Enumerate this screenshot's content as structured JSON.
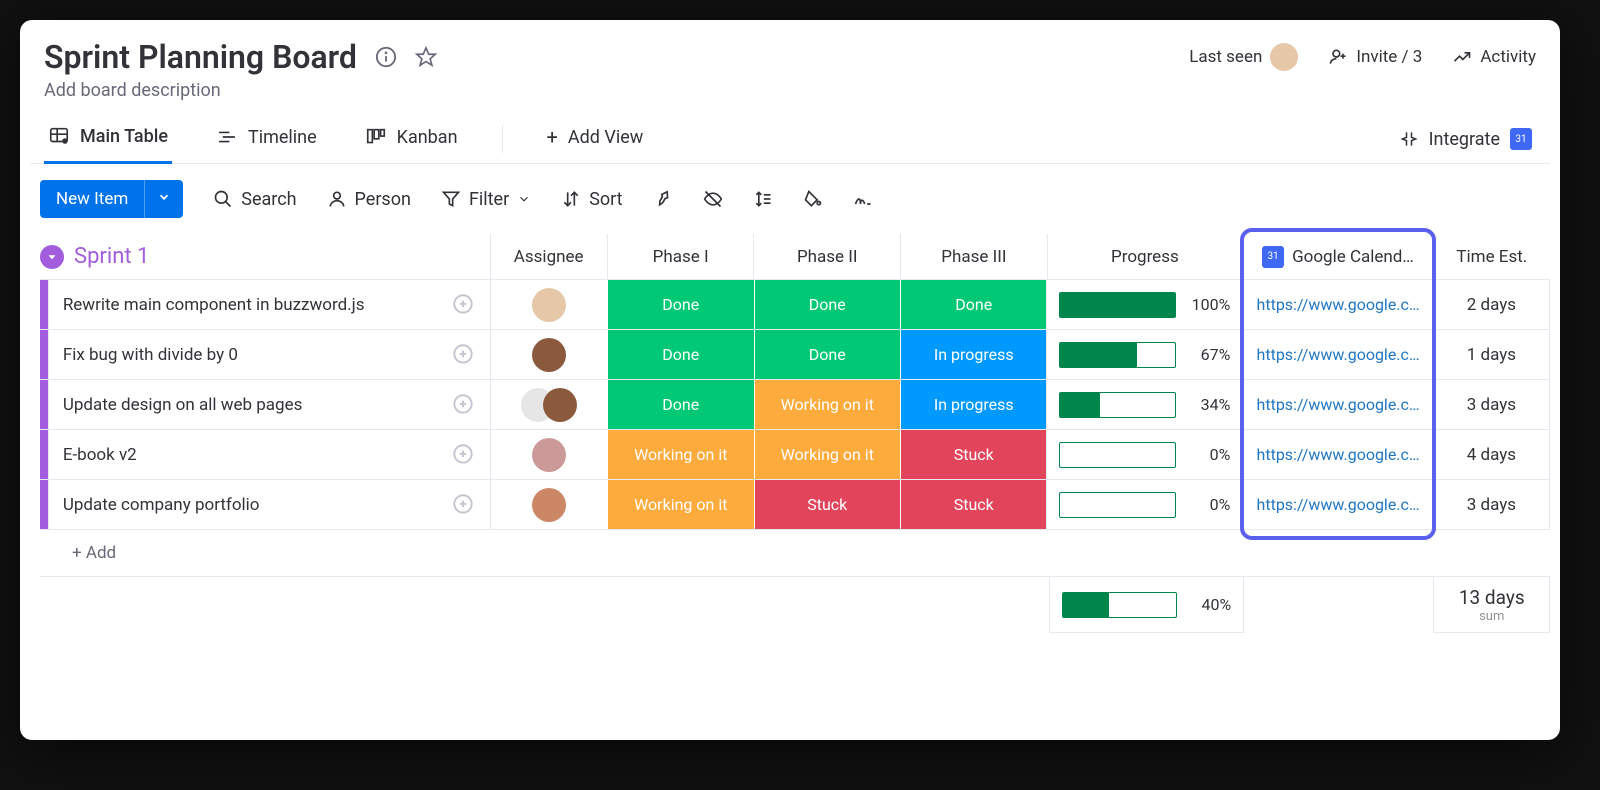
{
  "header": {
    "title": "Sprint Planning Board",
    "subtitle": "Add board description",
    "last_seen": "Last seen",
    "invite": "Invite / 3",
    "activity": "Activity"
  },
  "views": {
    "main_table": "Main Table",
    "timeline": "Timeline",
    "kanban": "Kanban",
    "add_view": "Add View",
    "integrate": "Integrate"
  },
  "toolbar": {
    "new_item": "New Item",
    "search": "Search",
    "person": "Person",
    "filter": "Filter",
    "sort": "Sort"
  },
  "group": {
    "name": "Sprint 1",
    "columns": {
      "assignee": "Assignee",
      "phase1": "Phase I",
      "phase2": "Phase II",
      "phase3": "Phase III",
      "progress": "Progress",
      "gcal": "Google Calend…",
      "time_est": "Time Est."
    },
    "status_labels": {
      "done": "Done",
      "working": "Working on it",
      "in_progress": "In progress",
      "stuck": "Stuck"
    },
    "rows": [
      {
        "name": "Rewrite main component in buzzword.js",
        "phase1": "done",
        "phase2": "done",
        "phase3": "done",
        "progress": 100,
        "gcal": "https://www.google.c…",
        "time": "2 days"
      },
      {
        "name": "Fix bug with divide by 0",
        "phase1": "done",
        "phase2": "done",
        "phase3": "in_progress",
        "progress": 67,
        "gcal": "https://www.google.c…",
        "time": "1 days"
      },
      {
        "name": "Update design on all web pages",
        "phase1": "done",
        "phase2": "working",
        "phase3": "in_progress",
        "progress": 34,
        "gcal": "https://www.google.c…",
        "time": "3 days"
      },
      {
        "name": "E-book v2",
        "phase1": "working",
        "phase2": "working",
        "phase3": "stuck",
        "progress": 0,
        "gcal": "https://www.google.c…",
        "time": "4 days"
      },
      {
        "name": "Update company portfolio",
        "phase1": "working",
        "phase2": "stuck",
        "phase3": "stuck",
        "progress": 0,
        "gcal": "https://www.google.c…",
        "time": "3 days"
      }
    ],
    "add_row": "+ Add",
    "footer": {
      "progress": 40,
      "time_total": "13 days",
      "time_sum_label": "sum"
    }
  }
}
